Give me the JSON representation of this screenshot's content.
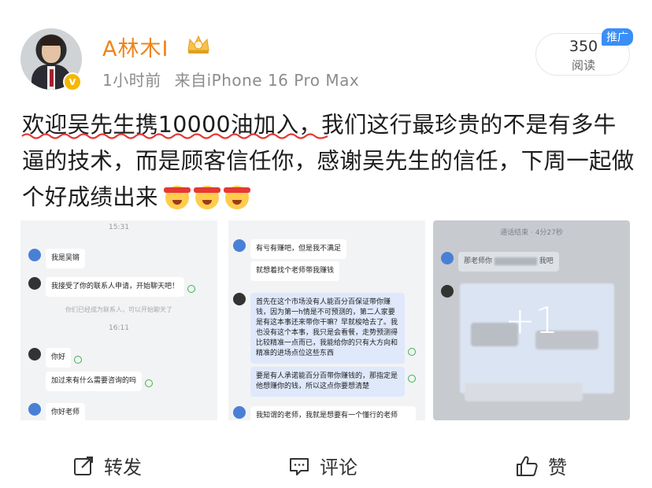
{
  "author": {
    "name": "A林木I",
    "time": "1小时前",
    "source": "来自iPhone 16 Pro Max",
    "verified_badge": "v"
  },
  "stats": {
    "reads": "350",
    "reads_label": "阅读",
    "promo_label": "推广"
  },
  "post": {
    "text": "欢迎吴先生携10000油加入，我们这行最珍贵的不是有多牛逼的技术，而是顾客信任你，感谢吴先生的信任，下周一起做个好成绩出来",
    "emojis": [
      "celebrate-emoji",
      "celebrate-emoji",
      "celebrate-emoji"
    ]
  },
  "images": {
    "shot1": {
      "time1": "15:31",
      "msg1": "我是吴锵",
      "msg2": "我接受了你的联系人申请，开始聊天吧！",
      "sys": "你们已经成为联系人，可以开始聊天了",
      "time2": "16:11",
      "msg3": "你好",
      "msg4": "加过来有什么需要咨询的吗",
      "msg5": "你好老师"
    },
    "shot2": {
      "msg1": "有亏有赚吧，但是我不满足",
      "msg2": "就想着找个老师带我赚钱",
      "msg3": "首先在这个市场没有人能百分百保证带你赚钱，因为第一h情是不可预测的，第二人家要是有这本事还来带你干嘛？早就梭哈去了。我也没有这个本事，我只是会看餐，走势预测得比较精准一点而已，我能给你的只有大方向和精准的进场点位这些东西",
      "msg4": "要是有人承诺能百分百带你赚钱的，那指定是他想赚你的钱，所以这点你要想清楚",
      "msg5": "我知谓的老师，我就是想要有一个懂行的老师"
    },
    "shot3": {
      "header": "通话结束 · 4分27秒",
      "msg1": "那老师你",
      "msg1b": "我吧",
      "more": "+1"
    }
  },
  "actions": {
    "repost": "转发",
    "comment": "评论",
    "like": "赞"
  },
  "colors": {
    "username": "#f08419",
    "promo": "#3a8ef6",
    "squiggle": "#e53935"
  }
}
